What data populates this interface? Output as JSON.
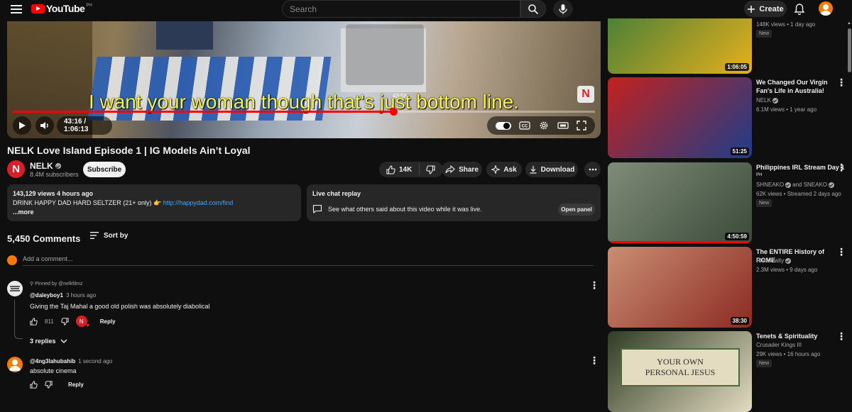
{
  "header": {
    "logo_text": "YouTube",
    "country_code": "PH",
    "search_placeholder": "Search",
    "create_label": "Create"
  },
  "player": {
    "caption": "I want your woman though that's just bottom line.",
    "preview_time": "43:58",
    "time_display": "43:16 / 1:06:13",
    "progress_fraction": 0.6534,
    "channel_badge": "N"
  },
  "video": {
    "title": "NELK Love Island Episode 1 | IG Models Ain’t Loyal",
    "channel_initial": "N",
    "channel_name": "NELK",
    "subscribers": "8.4M subscribers",
    "subscribe_label": "Subscribe",
    "like_count": "14K",
    "share_label": "Share",
    "ask_label": "Ask",
    "download_label": "Download",
    "views_time": "143,129 views  4 hours ago",
    "description": "DRINK HAPPY DAD HARD SELTZER (21+ only) 👉 ",
    "description_link": "http://happydad.com/find",
    "more_label": "...more"
  },
  "live_chat": {
    "title": "Live chat replay",
    "text": "See what others said about this video while it was live.",
    "button": "Open panel"
  },
  "comments": {
    "count": "5,450 Comments",
    "sort_label": "Sort by",
    "add_placeholder": "Add a comment...",
    "items": [
      {
        "pinned": "Pinned by @nelkfilmz",
        "author": "@daleyboy1",
        "time": "3 hours ago",
        "text": "Giving the Taj Mahal a good old polish was absolutely diabolical",
        "likes": "811",
        "reply_label": "Reply",
        "replies_label": "3 replies"
      },
      {
        "author": "@4ng3lahubahib",
        "time": "1 second ago",
        "text": "absolute cinema",
        "reply_label": "Reply"
      }
    ]
  },
  "sidebar": {
    "items": [
      {
        "duration": "1:06:05",
        "meta": "148K views • 1 day ago",
        "badge": "New",
        "colors": [
          "#3a7a3a",
          "#e6b01c"
        ]
      },
      {
        "duration": "51:25",
        "title": "We Changed Our Virgin Fan's Life in Australia!",
        "channel": "NELK",
        "meta": "6.1M views • 1 year ago",
        "colors": [
          "#c2221f",
          "#1e3d8a"
        ]
      },
      {
        "duration": "4:50:59",
        "title": "Philippines IRL Stream Day 1",
        "tag": "PH",
        "channel": "SHNEAKO",
        "channel_extra": "and SNEAKO",
        "meta": "62K views • Streamed 2 days ago",
        "badge": "New",
        "colors": [
          "#7f8c78",
          "#3b4a3a"
        ]
      },
      {
        "duration": "38:30",
        "title": "The ENTIRE History of ROME",
        "channel": "Historicalty",
        "meta": "2.3M views • 9 days ago",
        "colors": [
          "#c98e73",
          "#8c2a22"
        ]
      },
      {
        "title": "Tenets & Spirituality",
        "channel": "Crusader Kings III",
        "meta": "29K views • 16 hours ago",
        "badge": "New",
        "thumb_text_1": "YOUR OWN",
        "thumb_text_2": "PERSONAL JESUS",
        "colors": [
          "#2f3b24",
          "#e3dcc1"
        ]
      }
    ]
  }
}
